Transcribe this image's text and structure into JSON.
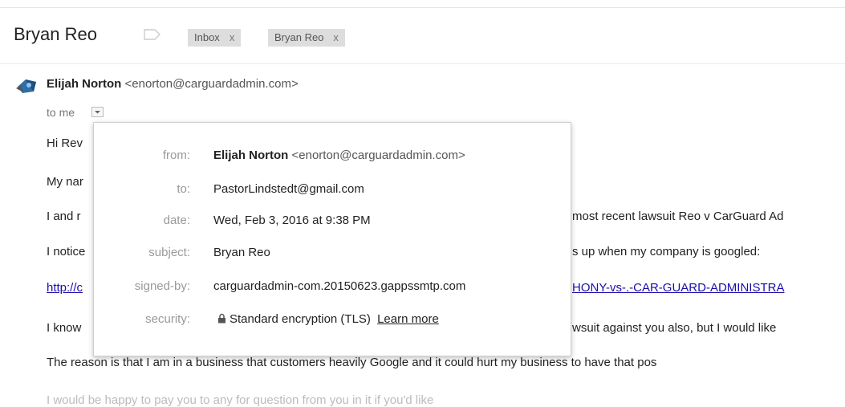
{
  "thread": {
    "subject": "Bryan Reo",
    "labels": [
      {
        "name": "Inbox",
        "remove": "x"
      },
      {
        "name": "Bryan Reo",
        "remove": "x"
      }
    ]
  },
  "message": {
    "sender_name": "Elijah Norton",
    "sender_email": "<enorton@carguardadmin.com>",
    "to_line": "to me",
    "body_lines": [
      "Hi Rev",
      "My nar",
      "I and r",
      "I notice",
      "http://c",
      "I know",
      "The reason is that I am in a business that customers heavily Google and it could hurt my business to have that pos"
    ],
    "body_right": [
      "most recent lawsuit Reo v CarGuard Ad",
      "s up when my company is googled:",
      "HONY-vs-.-CAR-GUARD-ADMINISTRA",
      "wsuit against you also, but I would like"
    ],
    "faded_line": "I would be happy to pay you to any for question from you in it if you'd like"
  },
  "details_popup": {
    "rows": [
      {
        "label": "from:",
        "value_name": "Elijah Norton",
        "value_email": "<enorton@carguardadmin.com>"
      },
      {
        "label": "to:",
        "value": "PastorLindstedt@gmail.com"
      },
      {
        "label": "date:",
        "value": "Wed, Feb 3, 2016 at 9:38 PM"
      },
      {
        "label": "subject:",
        "value": "Bryan Reo"
      },
      {
        "label": "signed-by:",
        "value": "carguardadmin-com.20150623.gappssmtp.com"
      },
      {
        "label": "security:",
        "value": "Standard encryption (TLS)",
        "link": "Learn more"
      }
    ]
  },
  "icons": {
    "label": "label-tag-icon",
    "dropdown": "chevron-down-icon",
    "lock": "lock-icon",
    "avatar": "sender-avatar"
  },
  "colors": {
    "link": "#1a0dab",
    "chip_bg": "#dddddd"
  }
}
